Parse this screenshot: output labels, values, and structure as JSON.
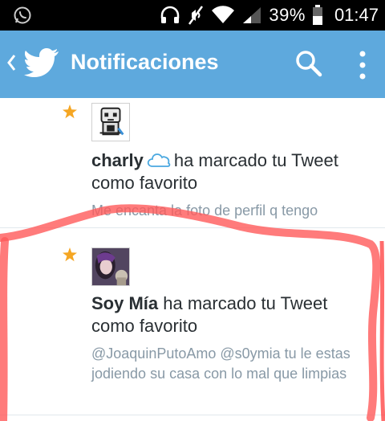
{
  "status_bar": {
    "battery_percent": "39%",
    "time": "01:47",
    "icons": [
      "whatsapp-icon",
      "headphones-icon",
      "mute-icon",
      "wifi-icon",
      "signal-icon",
      "battery-icon"
    ]
  },
  "action_bar": {
    "title": "Notificaciones",
    "color": "#5ea9dd",
    "icons": [
      "back-icon",
      "twitter-bird-icon",
      "search-icon",
      "overflow-menu-icon"
    ]
  },
  "notifications": [
    {
      "user": "charly",
      "action": "ha marcado tu Tweet como favorito",
      "tweet_text": "Me encanta la foto de perfil q tengo",
      "star_color": "#f5a623"
    },
    {
      "user": "Soy Mía",
      "action": "ha marcado tu Tweet como favorito",
      "tweet_text": "@JoaquinPutoAmo @s0ymia tu le estas jodiendo su casa con lo mal que limpias",
      "star_color": "#f5a623"
    }
  ]
}
